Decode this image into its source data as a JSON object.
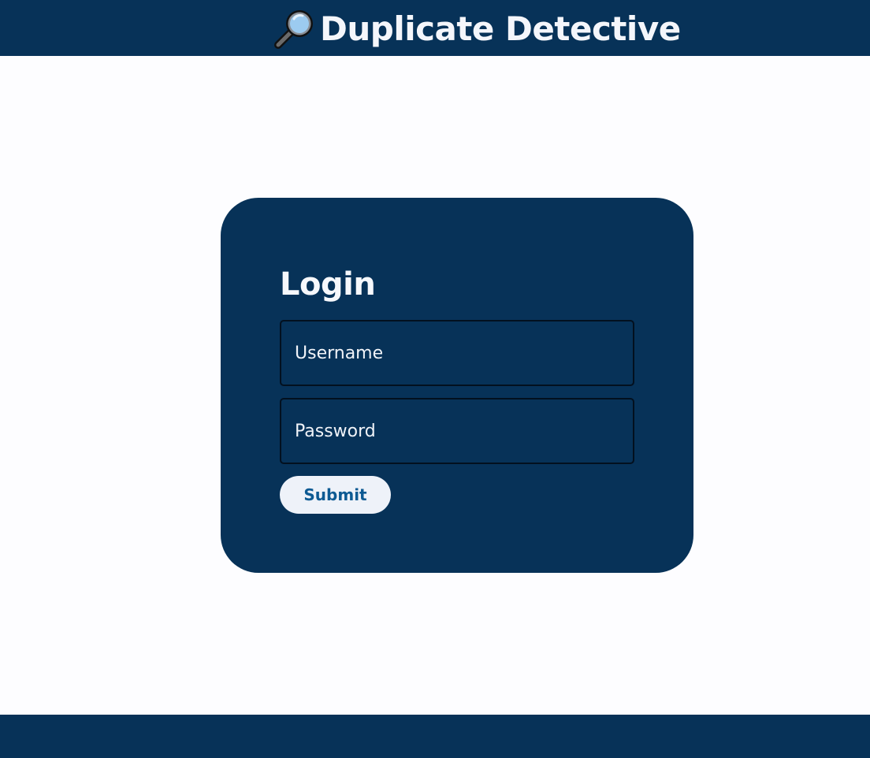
{
  "header": {
    "title": "Duplicate Detective",
    "icon": "magnifying-glass-icon"
  },
  "login": {
    "title": "Login",
    "username_placeholder": "Username",
    "password_placeholder": "Password",
    "submit_label": "Submit"
  },
  "colors": {
    "brand": "#073258",
    "page_background": "#fdfdff",
    "button_background": "#eef2f9",
    "button_text": "#0d5a93"
  }
}
